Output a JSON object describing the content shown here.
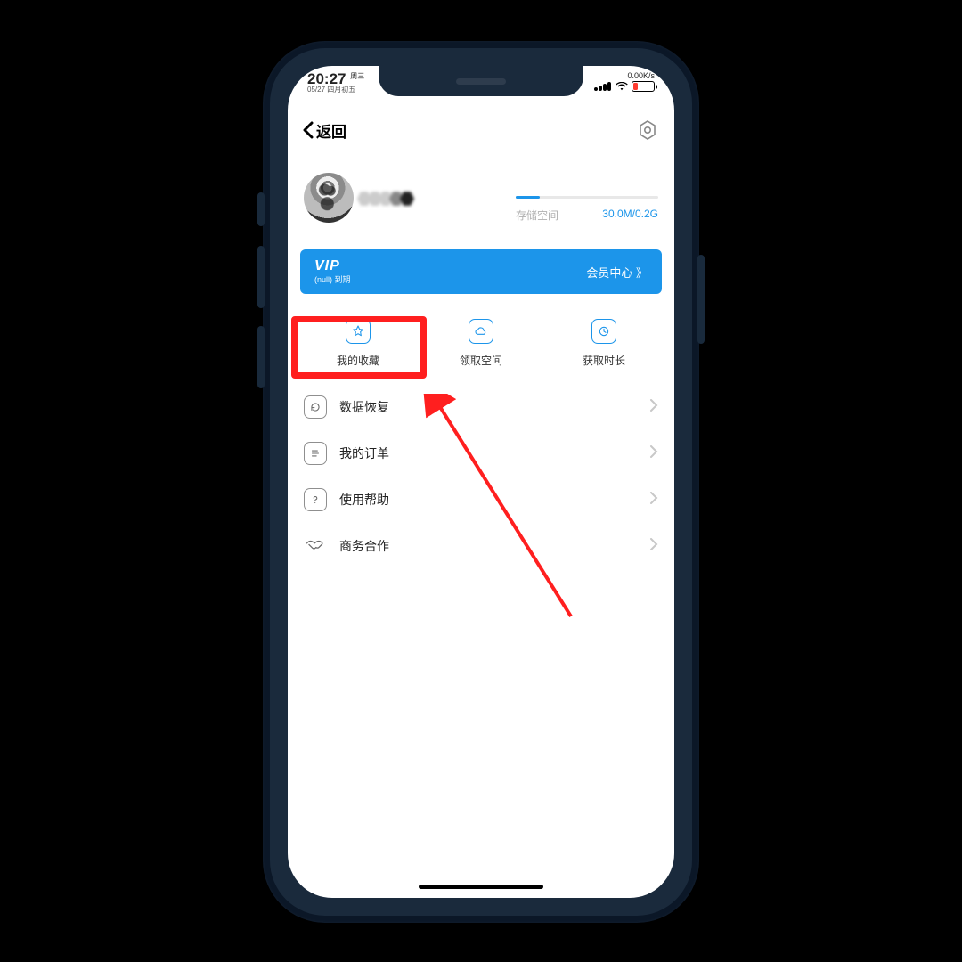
{
  "status": {
    "time": "20:27",
    "dayTag": "周三",
    "subDate": "05/27 四月初五",
    "netSpeed": "0.00K/s"
  },
  "nav": {
    "backLabel": "返回"
  },
  "profile": {
    "storageLabel": "存储空间",
    "storageValue": "30.0M/0.2G"
  },
  "vip": {
    "title": "VIP",
    "subtitle": "(null) 到期",
    "action": "会员中心 》"
  },
  "features": [
    {
      "label": "我的收藏"
    },
    {
      "label": "领取空间"
    },
    {
      "label": "获取时长"
    }
  ],
  "menu": [
    {
      "label": "数据恢复"
    },
    {
      "label": "我的订单"
    },
    {
      "label": "使用帮助"
    },
    {
      "label": "商务合作"
    }
  ],
  "colors": {
    "accent": "#1c95ea",
    "highlightRed": "#ff1f1f",
    "batteryLow": "#ff3b30"
  }
}
